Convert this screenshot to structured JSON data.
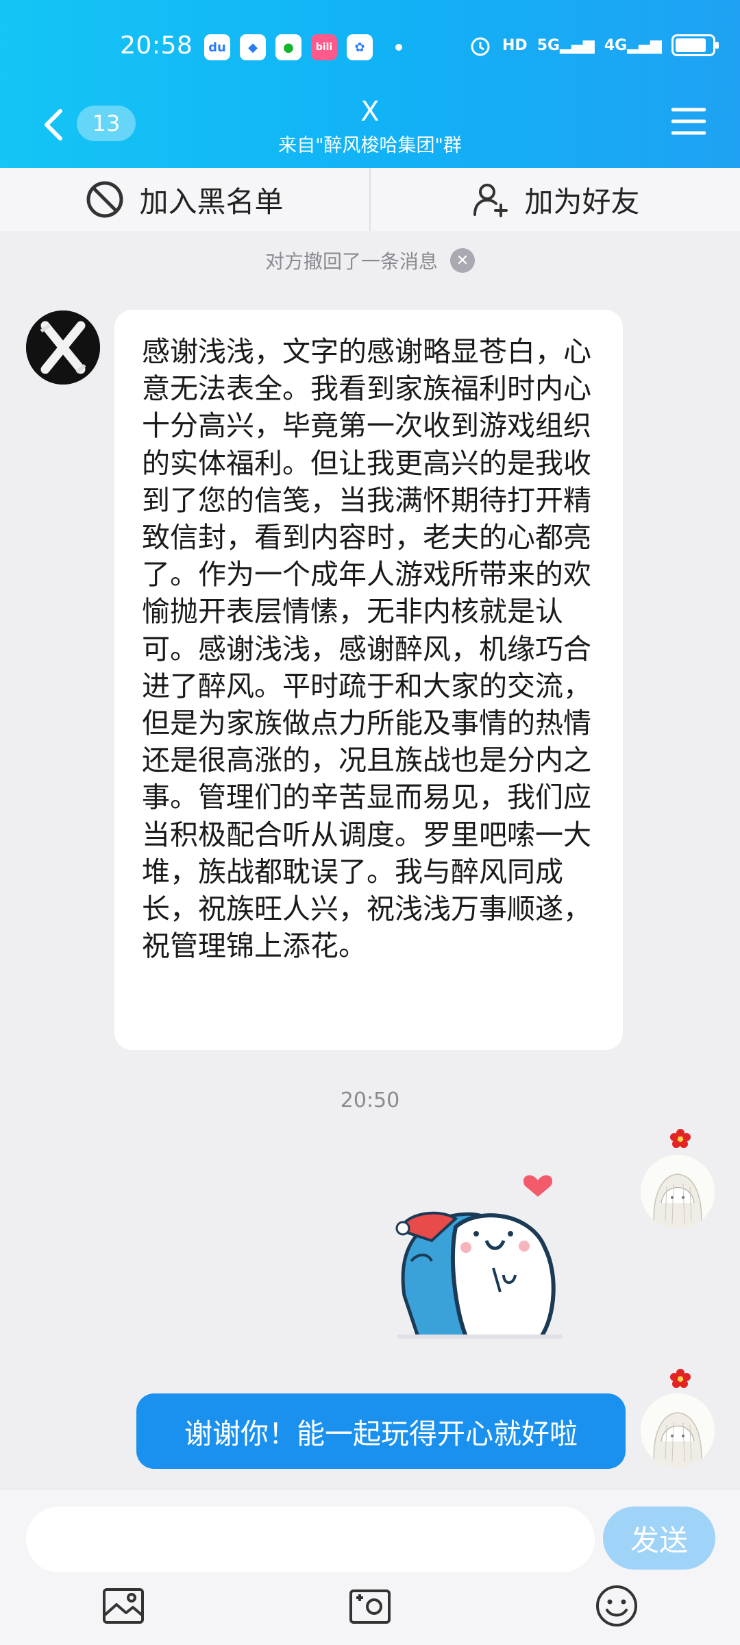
{
  "status_bar": {
    "time": "20:58",
    "network_labels": [
      "HD",
      "5G",
      "4G"
    ]
  },
  "header": {
    "back_badge": "13",
    "title": "X",
    "subtitle": "来自\"醉风梭哈集团\"群"
  },
  "actions": {
    "blacklist": "加入黑名单",
    "add_friend": "加为好友"
  },
  "chat": {
    "recall_notice": "对方撤回了一条消息",
    "incoming_message": "感谢浅浅，文字的感谢略显苍白，心意无法表全。我看到家族福利时内心十分高兴，毕竟第一次收到游戏组织的实体福利。但让我更高兴的是我收到了您的信笺，当我满怀期待打开精致信封，看到内容时，老夫的心都亮了。作为一个成年人游戏所带来的欢愉抛开表层情愫，无非内核就是认可。感谢浅浅，感谢醉风，机缘巧合进了醉风。平时疏于和大家的交流，但是为家族做点力所能及事情的热情还是很高涨的，况且族战也是分内之事。管理们的辛苦显而易见，我们应当积极配合听从调度。罗里吧嗦一大堆，族战都耽误了。我与醉风同成长，祝族旺人兴，祝浅浅万事顺遂，祝管理锦上添花。",
    "timestamp": "20:50",
    "outgoing_message": "谢谢你！能一起玩得开心就好啦"
  },
  "input": {
    "placeholder": "",
    "send_label": "发送"
  },
  "colors": {
    "header_start": "#14c5f5",
    "header_end": "#1fa2f3",
    "outgoing_bubble": "#1a91ef",
    "send_button": "#9fd3f7"
  }
}
